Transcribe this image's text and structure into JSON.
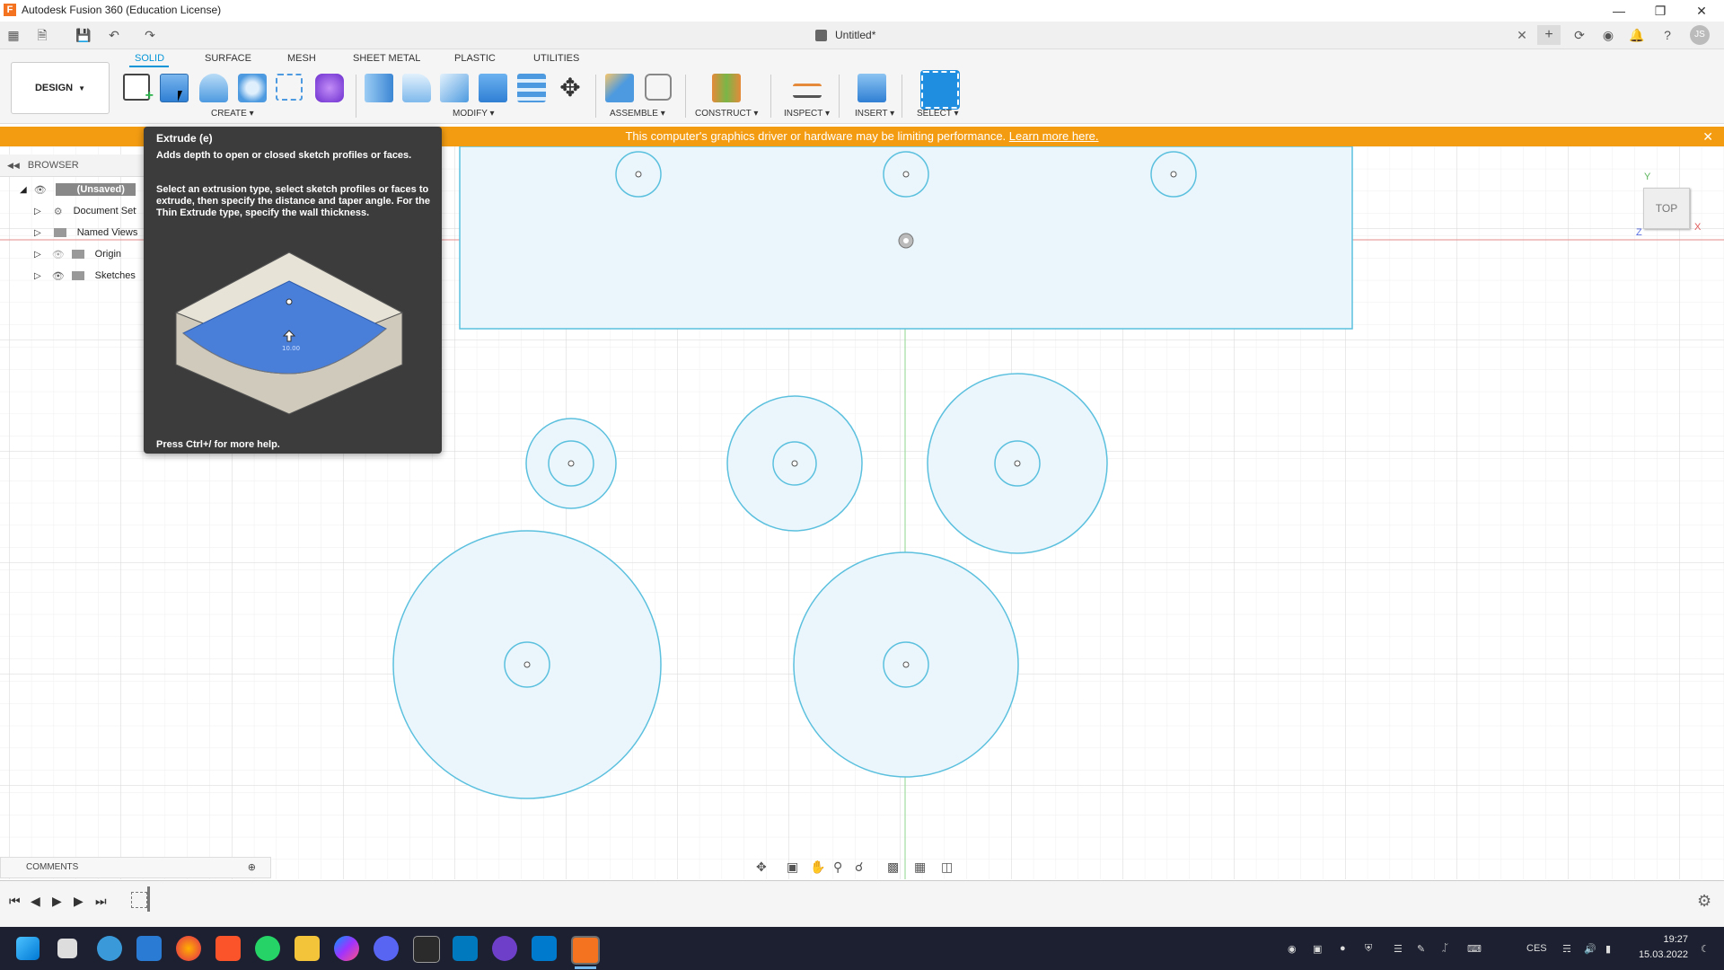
{
  "window": {
    "title": "Autodesk Fusion 360 (Education License)",
    "doc_title": "Untitled*",
    "user_initials": "JS"
  },
  "workspace": {
    "label": "DESIGN"
  },
  "ribbon": {
    "tabs": [
      "SOLID",
      "SURFACE",
      "MESH",
      "SHEET METAL",
      "PLASTIC",
      "UTILITIES"
    ],
    "active_tab": "SOLID",
    "groups": {
      "create": "CREATE",
      "modify": "MODIFY",
      "assemble": "ASSEMBLE",
      "construct": "CONSTRUCT",
      "inspect": "INSPECT",
      "insert": "INSERT",
      "select": "SELECT"
    }
  },
  "warning": {
    "text": "This computer's graphics driver or hardware may be limiting performance.",
    "link": "Learn more here."
  },
  "browser": {
    "label": "BROWSER",
    "root": "(Unsaved)",
    "items": [
      "Document Settings",
      "Named Views",
      "Origin",
      "Sketches"
    ]
  },
  "tooltip": {
    "title": "Extrude (e)",
    "desc1": "Adds depth to open or closed sketch profiles or faces.",
    "desc2": "Select an extrusion type, select sketch profiles or faces to extrude, then specify the distance and taper angle. For the Thin Extrude type, specify the wall thickness.",
    "footer": "Press Ctrl+/ for more help.",
    "image_value": "10.00"
  },
  "viewcube": {
    "face": "TOP",
    "x": "X",
    "y": "Y",
    "z": "Z"
  },
  "comments": {
    "label": "COMMENTS"
  },
  "taskbar": {
    "lang": "CES",
    "time": "19:27",
    "date": "15.03.2022"
  },
  "colors": {
    "accent": "#0696d7",
    "warning": "#f39c12",
    "sketch_line": "#5bc0de",
    "sketch_fill": "#eaf6fc",
    "taskbar": "#1c2030"
  }
}
